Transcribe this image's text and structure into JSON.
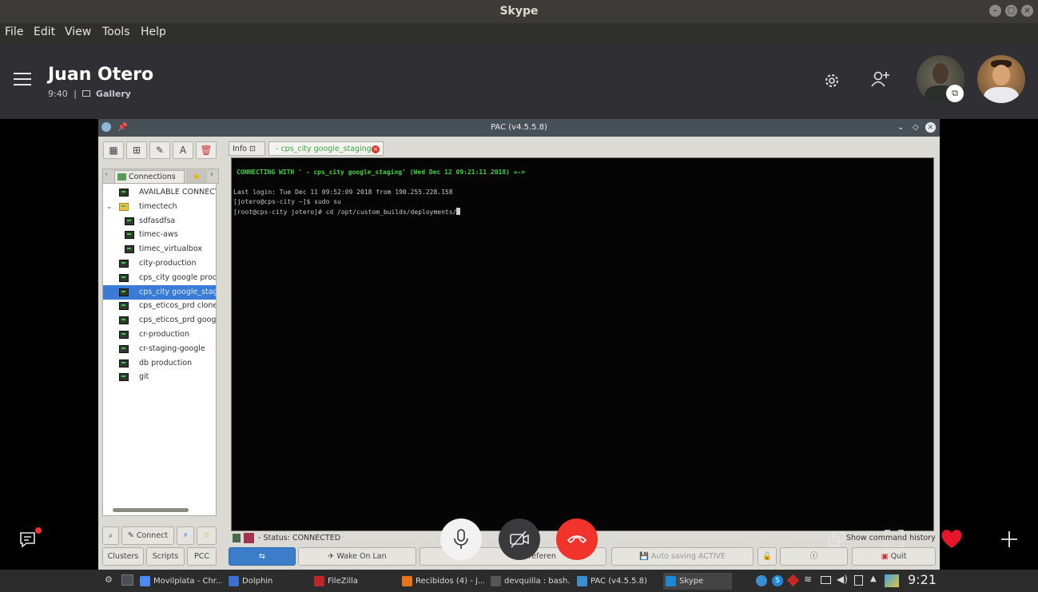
{
  "window": {
    "title": "Skype"
  },
  "menu": [
    "File",
    "Edit",
    "View",
    "Tools",
    "Help"
  ],
  "call": {
    "contact_name": "Juan Otero",
    "duration": "9:40",
    "separator": "|",
    "view_mode": "Gallery"
  },
  "pac": {
    "title": "PAC (v4.5.5.8)",
    "tabs": {
      "info": "Info",
      "session": "- cps_city google_staging"
    },
    "sidebar_tabs": {
      "connections": "Connections"
    },
    "tree": [
      {
        "label": "AVAILABLE CONNECT",
        "indent": 0
      },
      {
        "label": "timectech",
        "indent": 0
      },
      {
        "label": "sdfasdfsa",
        "indent": 1
      },
      {
        "label": "timec-aws",
        "indent": 1
      },
      {
        "label": "timec_virtualbox",
        "indent": 1
      },
      {
        "label": "city-production",
        "indent": 0
      },
      {
        "label": "cps_city google prod",
        "indent": 0
      },
      {
        "label": "cps_city google_stag",
        "indent": 0,
        "selected": true
      },
      {
        "label": "cps_eticos_prd clone",
        "indent": 0
      },
      {
        "label": "cps_eticos_prd goog",
        "indent": 0
      },
      {
        "label": "cr-production",
        "indent": 0
      },
      {
        "label": "cr-staging-google",
        "indent": 0
      },
      {
        "label": "db production",
        "indent": 0
      },
      {
        "label": "git",
        "indent": 0
      }
    ],
    "terminal": {
      "banner": "CONNECTING WITH ' - cps_city google_staging' (Wed Dec 12 09:21:11 2018) =->",
      "lines": [
        "Last login: Tue Dec 11 09:52:09 2018 from 190.255.228.158",
        "[jotero@cps-city ~]$ sudo su",
        "[root@cps-city jotero]# cd /opt/custom_builds/deployments/"
      ]
    },
    "status": "- Status: CONNECTED",
    "show_history": "Show command history",
    "buttons": {
      "connect": "Connect",
      "clusters": "Clusters",
      "scripts": "Scripts",
      "pcc": "PCC",
      "wake_on_lan": "Wake On Lan",
      "preferences": "Preferen",
      "auto_saving": "Auto saving ACTIVE",
      "quit": "Quit"
    }
  },
  "taskbar": {
    "tasks": [
      {
        "label": "Movilplata - Chr...",
        "color": "#4a8af4"
      },
      {
        "label": "Dolphin",
        "color": "#3d6fd1"
      },
      {
        "label": "FileZilla",
        "color": "#bf2626"
      },
      {
        "label": "Recibidos (4) - j...",
        "color": "#e8731d"
      },
      {
        "label": "devquilla : bash...",
        "color": "#555555"
      },
      {
        "label": "PAC (v4.5.5.8)",
        "color": "#3b8fd0"
      },
      {
        "label": "Skype",
        "color": "#1e88d8"
      }
    ],
    "clock": "9:21"
  },
  "icons": {
    "hamburger": "hamburger-menu-icon",
    "settings": "gear-icon",
    "add_person": "add-person-icon",
    "chat": "chat-icon",
    "mic": "microphone-icon",
    "video_off": "video-off-icon",
    "hangup": "hang-up-icon",
    "heart": "heart-icon",
    "plus": "plus-icon"
  },
  "colors": {
    "skype_header": "#302f34",
    "hangup_red": "#f0332b",
    "terminal_green": "#3ed43e",
    "selection_blue": "#3a7bd5"
  }
}
